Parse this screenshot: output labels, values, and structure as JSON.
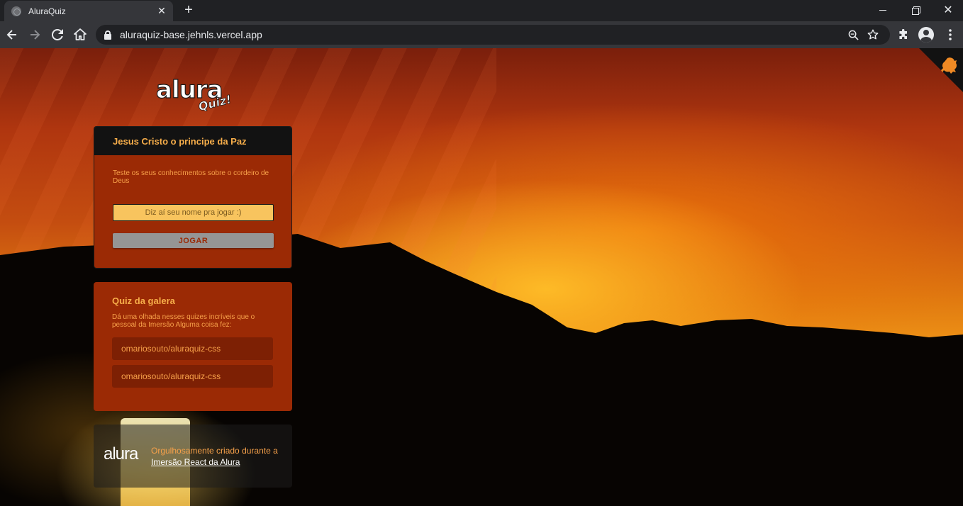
{
  "browser": {
    "tab_title": "AluraQuiz",
    "url": "aluraquiz-base.jehnls.vercel.app"
  },
  "logo": {
    "word": "alura",
    "badge": "Quiz!"
  },
  "main_card": {
    "title": "Jesus Cristo o principe da Paz",
    "description": "Teste os seus conhecimentos sobre o cordeiro de Deus",
    "input_placeholder": "Diz aí seu nome pra jogar :)",
    "input_value": "",
    "play_label": "JOGAR"
  },
  "galera_card": {
    "title": "Quiz da galera",
    "description": "Dá uma olhada nesses quizes incríveis que o pessoal da Imersão Alguma coisa fez:",
    "links": [
      "omariosouto/aluraquiz-css",
      "omariosouto/aluraquiz-css"
    ]
  },
  "footer": {
    "logo_text": "alura",
    "text": "Orgulhosamente criado durante a ",
    "link_text": "Imersão React da Alura"
  },
  "colors": {
    "card_bg": "#9b2a05",
    "header_bg": "#121212",
    "accent_text": "#f7ae4a",
    "input_bg": "#f8c45e",
    "button_bg": "#959595"
  }
}
